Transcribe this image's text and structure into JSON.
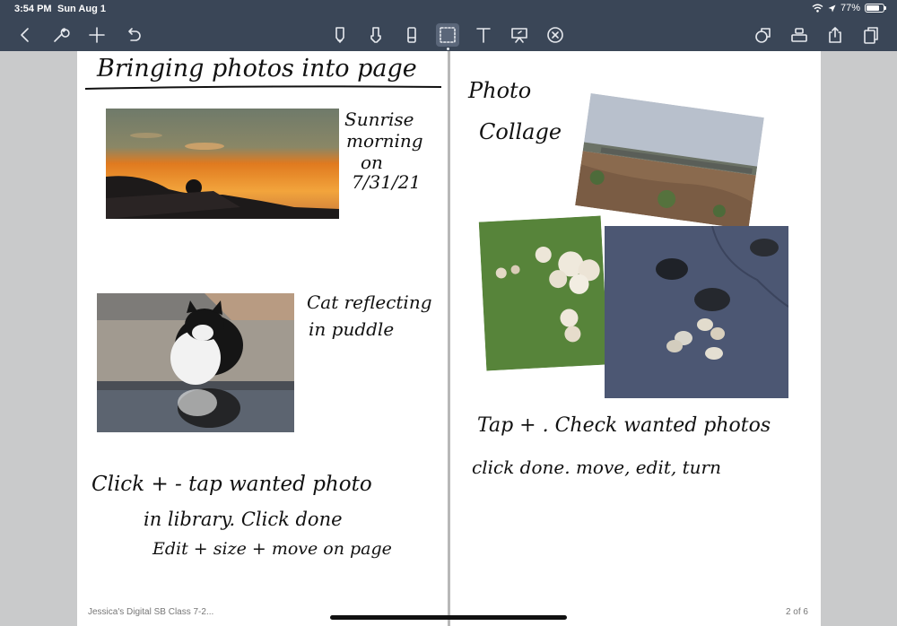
{
  "status": {
    "time": "3:54 PM",
    "date": "Sun Aug 1",
    "battery": "77%",
    "battery_level": 0.77
  },
  "toolbar": {
    "left": [
      "back-icon",
      "wrench-icon",
      "add-icon",
      "undo-icon"
    ],
    "center": [
      "pen-icon",
      "highlighter-icon",
      "eraser-icon",
      "lasso-icon",
      "text-icon",
      "presenter-icon",
      "close-circle-icon"
    ],
    "right": [
      "shapes-icon",
      "elements-icon",
      "share-icon",
      "pages-icon"
    ],
    "selected_tool": "lasso"
  },
  "notebook": {
    "left_page": {
      "title": "Bringing photos into page",
      "sunrise_caption": [
        "Sunrise",
        "morning",
        "on",
        "7/31/21"
      ],
      "cat_caption": [
        "Cat reflecting",
        "in puddle"
      ],
      "instructions": [
        "Click + - tap wanted photo",
        "in library. Click done",
        "Edit + size + move on page"
      ]
    },
    "right_page": {
      "title": [
        "Photo",
        "Collage"
      ],
      "instructions": [
        "Tap + . Check wanted photos",
        "click done. move, edit, turn"
      ]
    },
    "footer_title": "Jessica's Digital SB Class 7-2...",
    "page_indicator": "2 of 6"
  },
  "colors": {
    "chrome": "#3a4657",
    "page": "#ffffff",
    "ink": "#111111",
    "background": "#c9cacb"
  }
}
